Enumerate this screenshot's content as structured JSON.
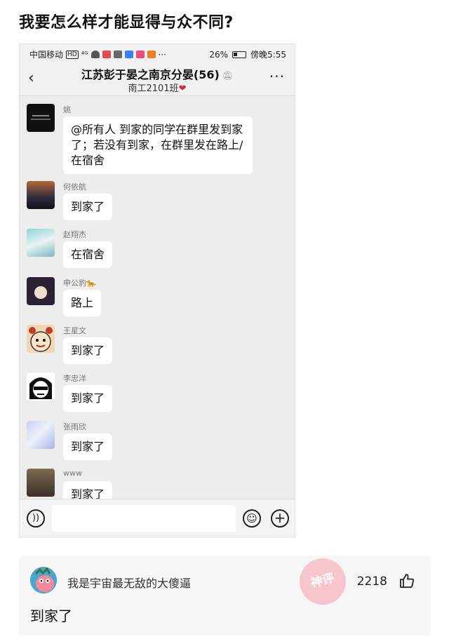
{
  "post_title": "我要怎么样才能显得与众不同?",
  "status_bar": {
    "carrier": "中国移动",
    "hd": "HD",
    "signal": "⁴ᴳ",
    "battery": "26%",
    "time": "傍晚5:55"
  },
  "chat": {
    "group_name": "江苏彭于晏之南京分晏(56)",
    "class_tag": "南工2101班"
  },
  "messages": [
    {
      "sender": "姚",
      "text": "@所有人  到家的同学在群里发到家了；若没有到家，在群里发在路上/在宿舍"
    },
    {
      "sender": "何依航",
      "text": "到家了"
    },
    {
      "sender": "赵翔杰",
      "text": "在宿舍"
    },
    {
      "sender": "申公豹🐆",
      "text": "路上"
    },
    {
      "sender": "王星文",
      "text": "到家了"
    },
    {
      "sender": "李忠洋",
      "text": "到家了"
    },
    {
      "sender": "张雨欣",
      "text": "到家了"
    },
    {
      "sender": "www",
      "text": "到家了"
    }
  ],
  "comment": {
    "username": "我是宇宙最无敌的大傻逼",
    "stamp": "神评",
    "likes": "2218",
    "text": "到家了"
  },
  "colors": {
    "chat_bg": "#ededed",
    "bubble": "#ffffff",
    "heart": "#e0263a",
    "stamp": "#f7b9c4"
  }
}
